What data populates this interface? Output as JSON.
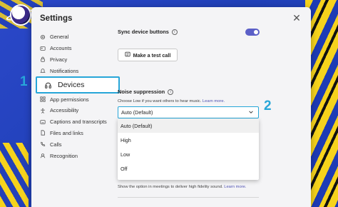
{
  "window": {
    "title": "Settings",
    "close_glyph": "✕"
  },
  "sidebar": {
    "items": [
      {
        "label": "General",
        "icon": "gear-icon"
      },
      {
        "label": "Accounts",
        "icon": "accounts-icon"
      },
      {
        "label": "Privacy",
        "icon": "lock-icon"
      },
      {
        "label": "Notifications",
        "icon": "bell-icon"
      },
      {
        "label": "Devices",
        "icon": "headset-icon",
        "active": true
      },
      {
        "label": "App permissions",
        "icon": "grid-icon"
      },
      {
        "label": "Accessibility",
        "icon": "accessibility-icon"
      },
      {
        "label": "Captions and transcripts",
        "icon": "captions-icon"
      },
      {
        "label": "Files and links",
        "icon": "file-icon"
      },
      {
        "label": "Calls",
        "icon": "phone-icon"
      },
      {
        "label": "Recognition",
        "icon": "recognition-icon"
      }
    ]
  },
  "main": {
    "sync_label": "Sync device buttons",
    "sync_enabled": true,
    "test_call_label": "Make a test call",
    "noise_title": "Noise suppression",
    "noise_desc": "Choose Low if you want others to hear music.",
    "learn_more": "Learn more.",
    "selected_value": "Auto (Default)",
    "options": [
      "Auto (Default)",
      "High",
      "Low",
      "Off"
    ],
    "hifi_text": "Show the option in meetings to deliver high fidelity sound.",
    "hifi_learn_more": "Learn more."
  },
  "callouts": {
    "one": "1",
    "two": "2"
  },
  "colors": {
    "accent": "#5b5fc7",
    "highlight": "#27a6d8",
    "link": "#4f52b2"
  }
}
